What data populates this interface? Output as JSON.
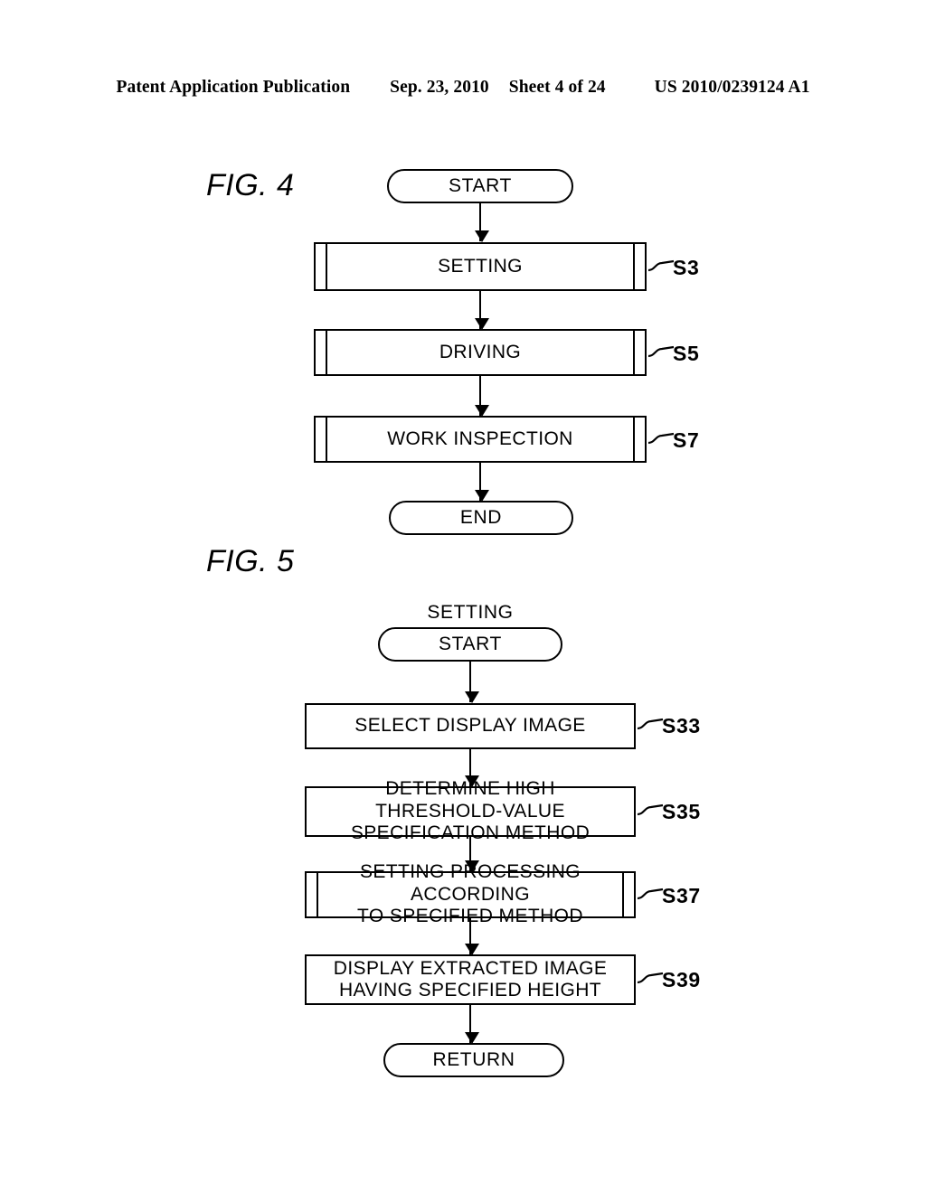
{
  "header": {
    "publication": "Patent Application Publication",
    "date": "Sep. 23, 2010",
    "sheet": "Sheet 4 of 24",
    "number": "US 2010/0239124 A1"
  },
  "figures": [
    {
      "label": "FIG. 4",
      "nodes": [
        {
          "id": "fig4-start",
          "kind": "terminal",
          "text": "START"
        },
        {
          "id": "fig4-s3",
          "kind": "predefined-process",
          "text": "SETTING",
          "step": "S3"
        },
        {
          "id": "fig4-s5",
          "kind": "predefined-process",
          "text": "DRIVING",
          "step": "S5"
        },
        {
          "id": "fig4-s7",
          "kind": "predefined-process",
          "text": "WORK INSPECTION",
          "step": "S7"
        },
        {
          "id": "fig4-end",
          "kind": "terminal",
          "text": "END"
        }
      ]
    },
    {
      "label": "FIG. 5",
      "caption": "SETTING",
      "nodes": [
        {
          "id": "fig5-start",
          "kind": "terminal",
          "text": "START"
        },
        {
          "id": "fig5-s33",
          "kind": "process",
          "text": "SELECT DISPLAY IMAGE",
          "step": "S33"
        },
        {
          "id": "fig5-s35",
          "kind": "process",
          "line1": "DETERMINE HIGH THRESHOLD-VALUE",
          "line2": "SPECIFICATION METHOD",
          "step": "S35"
        },
        {
          "id": "fig5-s37",
          "kind": "predefined-process",
          "line1": "SETTING PROCESSING ACCORDING",
          "line2": "TO SPECIFIED METHOD",
          "step": "S37"
        },
        {
          "id": "fig5-s39",
          "kind": "process",
          "line1": "DISPLAY EXTRACTED IMAGE",
          "line2": "HAVING SPECIFIED HEIGHT",
          "step": "S39"
        },
        {
          "id": "fig5-return",
          "kind": "terminal",
          "text": "RETURN"
        }
      ]
    }
  ],
  "colors": {
    "ink": "#000000",
    "page": "#ffffff"
  }
}
